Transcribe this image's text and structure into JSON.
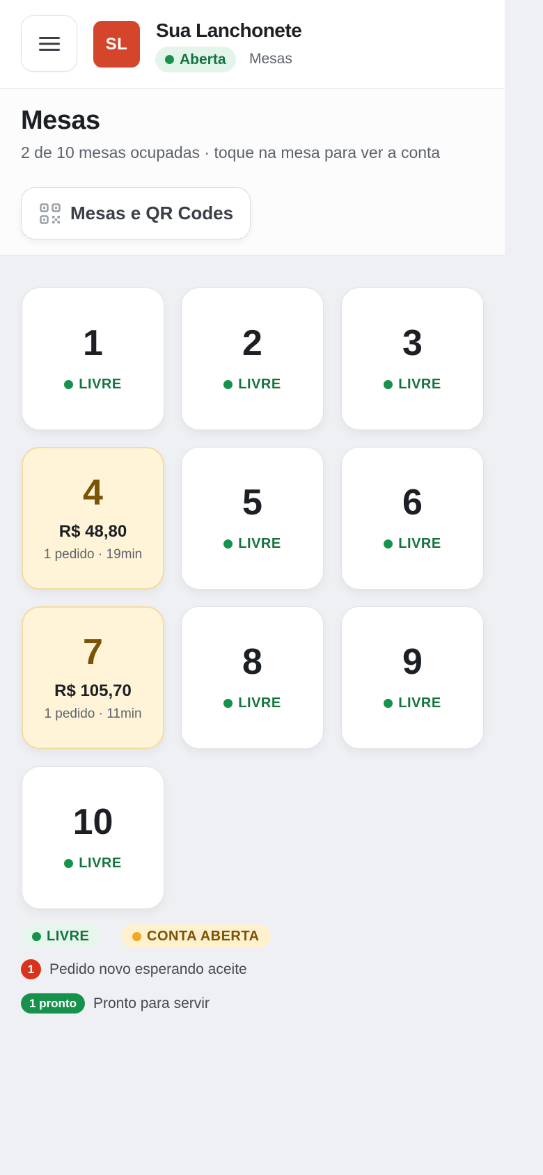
{
  "header": {
    "avatar_initials": "SL",
    "store_name": "Sua Lanchonete",
    "status": "Aberta",
    "breadcrumb": "Mesas",
    "menu_icon": "hamburger-menu-icon"
  },
  "page": {
    "title": "Mesas",
    "subtitle": "2 de 10 mesas ocupadas · toque na mesa para ver a conta",
    "qr_button_label": "Mesas e QR Codes",
    "qr_icon": "qr-code-icon"
  },
  "tables": [
    {
      "number": "1",
      "state": "free",
      "status": "LIVRE"
    },
    {
      "number": "2",
      "state": "free",
      "status": "LIVRE"
    },
    {
      "number": "3",
      "state": "free",
      "status": "LIVRE"
    },
    {
      "number": "4",
      "state": "open",
      "amount": "R$ 48,80",
      "meta": "1 pedido · 19min"
    },
    {
      "number": "5",
      "state": "free",
      "status": "LIVRE"
    },
    {
      "number": "6",
      "state": "free",
      "status": "LIVRE"
    },
    {
      "number": "7",
      "state": "open",
      "amount": "R$ 105,70",
      "meta": "1 pedido · 11min"
    },
    {
      "number": "8",
      "state": "free",
      "status": "LIVRE"
    },
    {
      "number": "9",
      "state": "free",
      "status": "LIVRE"
    },
    {
      "number": "10",
      "state": "free",
      "status": "LIVRE"
    }
  ],
  "legend": {
    "free_label": "LIVRE",
    "open_label": "CONTA ABERTA",
    "new_order_badge": "1",
    "new_order_text": "Pedido novo esperando aceite",
    "ready_badge": "1 pronto",
    "ready_text": "Pronto para servir"
  },
  "colors": {
    "brand": "#d4452c",
    "free_green": "#17924d",
    "open_amber": "#f2a623",
    "alert_red": "#d9331d"
  }
}
